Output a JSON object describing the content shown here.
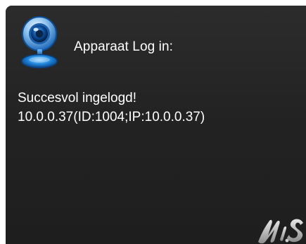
{
  "notification": {
    "title": "Apparaat Log in:",
    "icon": "webcam-icon",
    "message_lines": [
      "Succesvol ingelogd!",
      "10.0.0.37(ID:1004;IP:10.0.0.37)"
    ],
    "logo": {
      "text": "N.S",
      "icon": "brand-logo-icon"
    }
  },
  "colors": {
    "panel_background": "#252525",
    "text": "#ffffff",
    "icon_blue": "#2a8ad8",
    "icon_dark_blue": "#0b3f7a"
  }
}
